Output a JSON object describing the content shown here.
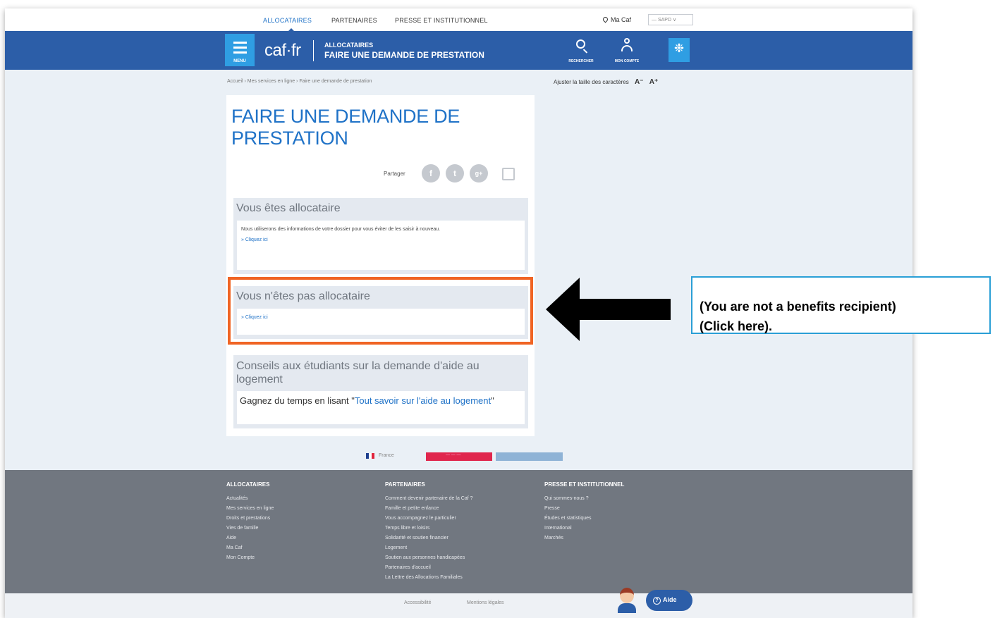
{
  "topnav": {
    "links": [
      "ALLOCATAIRES",
      "PARTENAIRES",
      "PRESSE ET INSTITUTIONNEL"
    ],
    "mycaf": "Ma Caf",
    "lang_select": "— SAPD ∨"
  },
  "header": {
    "menu_label": "MENU",
    "logo": "caf·fr",
    "category": "ALLOCATAIRES",
    "title": "FAIRE UNE DEMANDE DE PRESTATION",
    "tools": [
      "RECHERCHER",
      "MON COMPTE",
      ""
    ]
  },
  "breadcrumb": "Accueil › Mes services en ligne › Faire une demande de prestation",
  "font_size": {
    "label": "Ajuster la taille des caractères",
    "decrease": "A⁻",
    "increase": "A⁺"
  },
  "main": {
    "page_title": "FAIRE UNE DEMANDE DE PRESTATION",
    "share_label": "Partager",
    "share_buttons": [
      "f",
      "t",
      "g+"
    ],
    "blocks": [
      {
        "title": "Vous êtes allocataire",
        "text": "Nous utiliserons des informations de votre dossier pour vous éviter de les saisir à nouveau.",
        "link": "» Cliquez ici"
      },
      {
        "title": "Vous n'êtes pas allocataire",
        "link": "» Cliquez ici"
      },
      {
        "title": "Conseils aux étudiants sur la demande d'aide au logement",
        "text_prefix": "Gagnez du temps en lisant \"",
        "link": "Tout savoir sur l'aide au logement",
        "text_suffix": "\""
      }
    ]
  },
  "footer_badges": {
    "gov": "France",
    "red_badge": "— — —"
  },
  "footer": {
    "columns": [
      {
        "heading": "ALLOCATAIRES",
        "items": [
          "Actualités",
          "Mes services en ligne",
          "Droits et prestations",
          "Vies de famille",
          "Aide",
          "Ma Caf",
          "Mon Compte"
        ]
      },
      {
        "heading": "PARTENAIRES",
        "items": [
          "Comment devenir partenaire de la Caf ?",
          "Famille et petite enfance",
          "Vous accompagnez le particulier",
          "Temps libre et loisirs",
          "Solidarité et soutien financier",
          "Logement",
          "Soutien aux personnes handicapées",
          "Partenaires d'accueil",
          "La Lettre des Allocations Familiales"
        ]
      },
      {
        "heading": "PRESSE ET INSTITUTIONNEL",
        "items": [
          "Qui sommes-nous ?",
          "Presse",
          "Études et statistiques",
          "International",
          "Marchés"
        ]
      }
    ]
  },
  "bottom_bar": {
    "accessibility": "Accessibilité",
    "legal": "Mentions légales",
    "help": "Aide"
  },
  "annotation": {
    "line1": "(You are not a benefits recipient)",
    "line2": "(Click here)."
  }
}
